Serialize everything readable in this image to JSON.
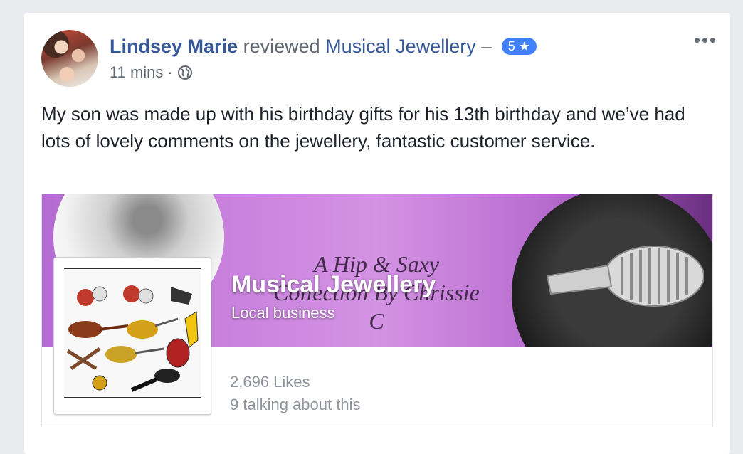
{
  "post": {
    "author": "Lindsey Marie",
    "action": "reviewed",
    "page": "Musical Jewellery",
    "separator": "–",
    "rating": "5 ★",
    "time": "11 mins",
    "dot": "·",
    "privacy_icon": "globe-icon",
    "text": "My son was made up with his birthday gifts for his 13th birthday and we’ve had lots of lovely comments on the jewellery, fantastic customer service."
  },
  "attachment": {
    "cover_text": "A Hip & Saxy Collection By Chrissie C",
    "page_name": "Musical Jewellery",
    "category": "Local business",
    "likes": "2,696 Likes",
    "talking": "9 talking about this"
  },
  "colors": {
    "link": "#365899",
    "badge": "#4080ff",
    "cover_purple": "#c77fdc"
  }
}
